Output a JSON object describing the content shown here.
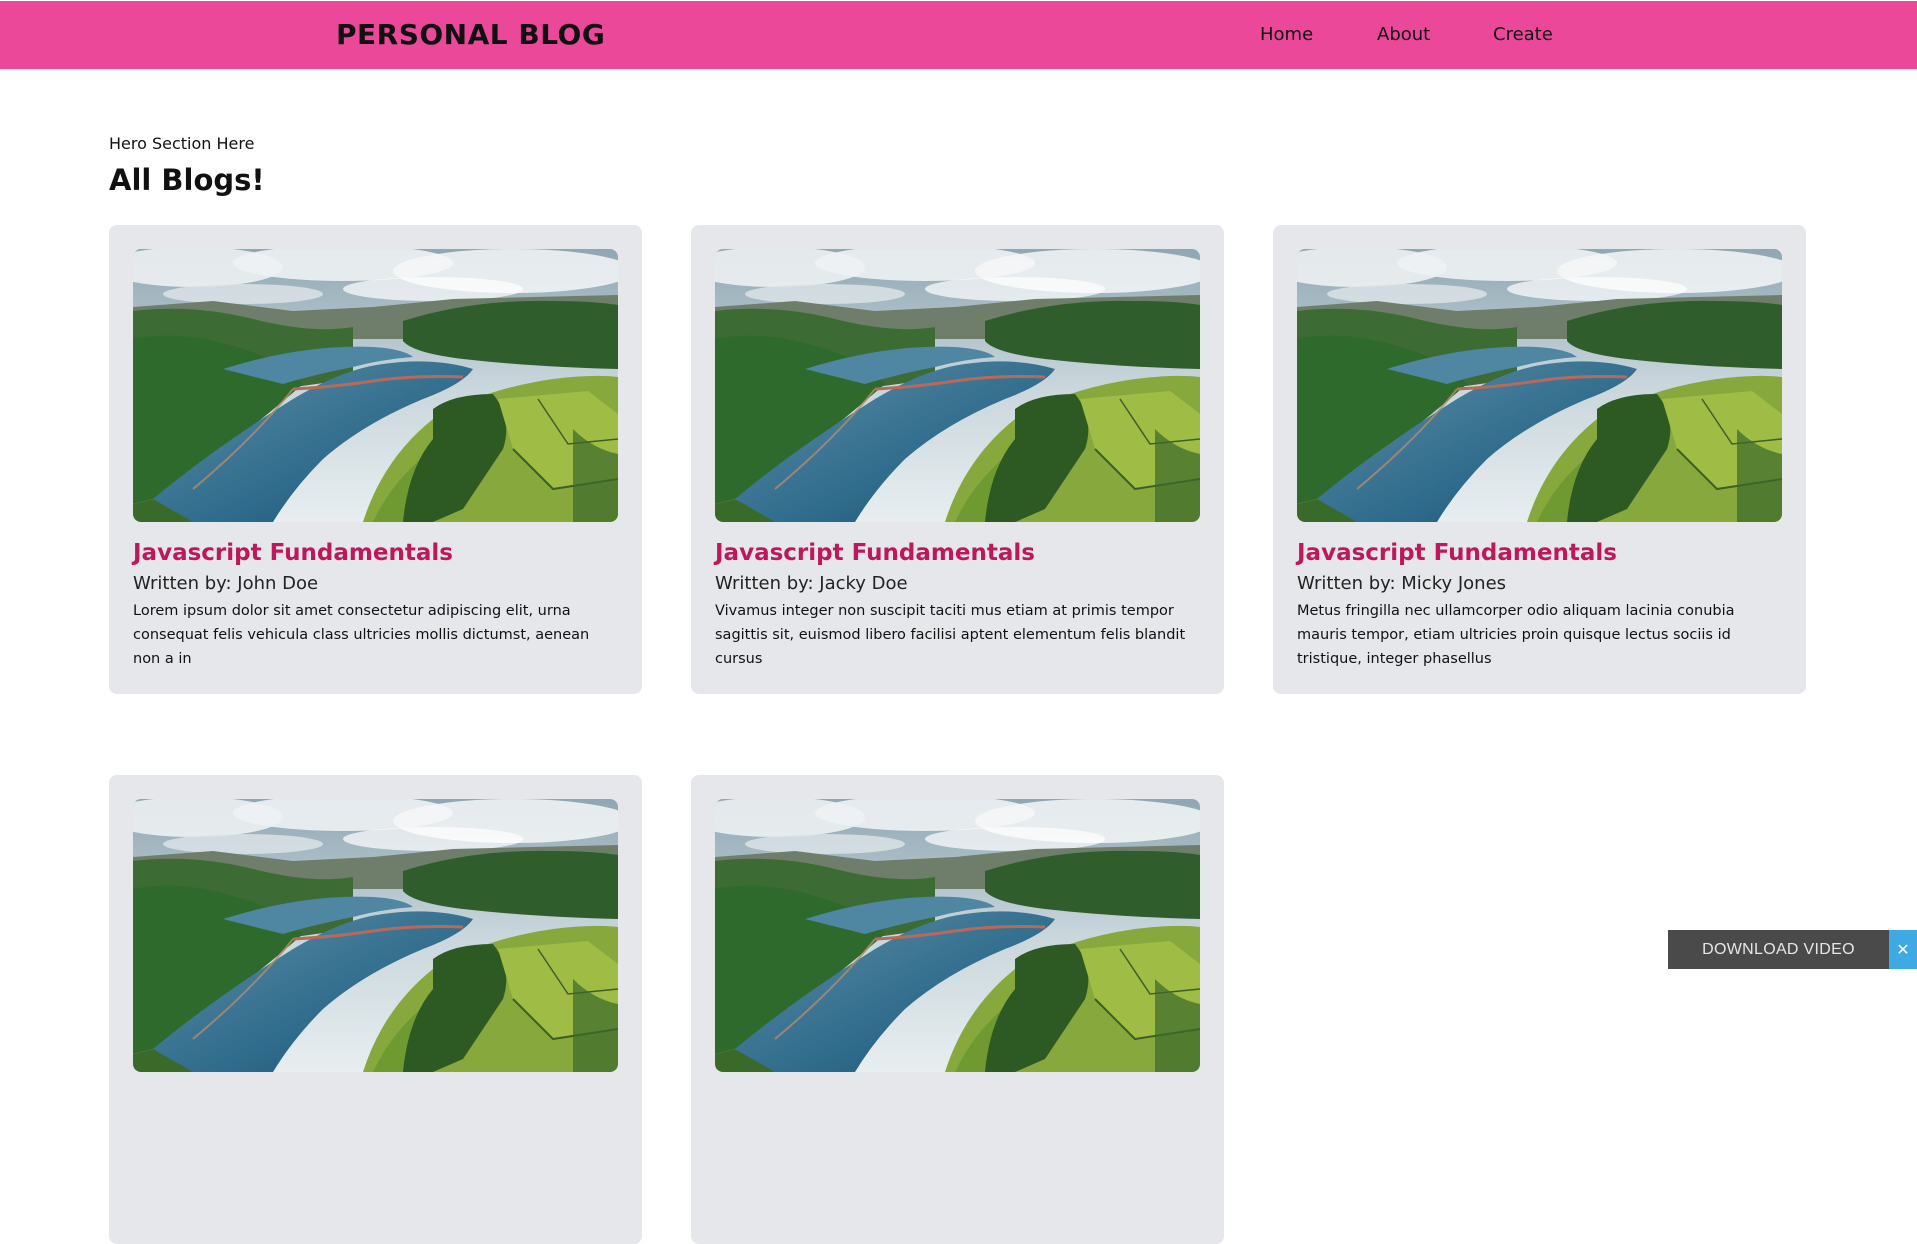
{
  "navbar": {
    "brand": "PERSONAL BLOG",
    "links": [
      "Home",
      "About",
      "Create"
    ],
    "background": "#ec4899"
  },
  "hero": {
    "text": "Hero Section Here"
  },
  "section": {
    "title": "All Blogs!"
  },
  "blogs": [
    {
      "title": "Javascript Fundamentals",
      "author": "Written by: John Doe",
      "body": "Lorem ipsum dolor sit amet consectetur adipiscing elit, urna consequat felis vehicula class ultricies mollis dictumst, aenean non a in",
      "image": "landscape-river-photo"
    },
    {
      "title": "Javascript Fundamentals",
      "author": "Written by: Jacky Doe",
      "body": "Vivamus integer non suscipit taciti mus etiam at primis tempor sagittis sit, euismod libero facilisi aptent elementum felis blandit cursus",
      "image": "landscape-river-photo"
    },
    {
      "title": "Javascript Fundamentals",
      "author": "Written by: Micky Jones",
      "body": "Metus fringilla nec ullamcorper odio aliquam lacinia conubia mauris tempor, etiam ultricies proin quisque lectus sociis id tristique, integer phasellus",
      "image": "landscape-river-photo"
    },
    {
      "title": "",
      "author": "",
      "body": "",
      "image": "landscape-river-photo"
    },
    {
      "title": "",
      "author": "",
      "body": "",
      "image": "landscape-river-photo"
    }
  ],
  "download_bar": {
    "label": "DOWNLOAD VIDEO",
    "close": "✕",
    "close_icon": "close-icon"
  },
  "colors": {
    "accent": "#ec4899",
    "title": "#be185d",
    "card": "#e5e7eb",
    "close_button": "#3fa9e4",
    "download_bar": "#4a4a4a"
  }
}
